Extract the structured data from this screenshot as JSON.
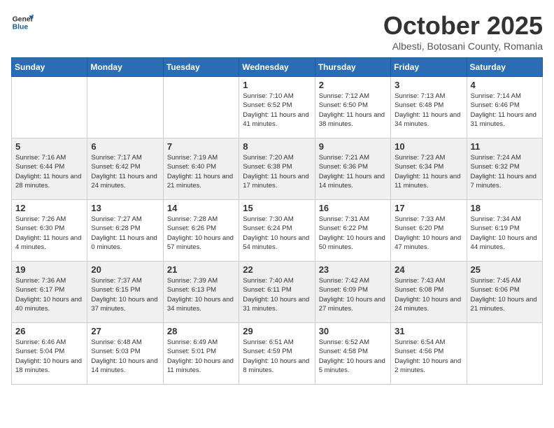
{
  "header": {
    "logo_line1": "General",
    "logo_line2": "Blue",
    "title": "October 2025",
    "subtitle": "Albesti, Botosani County, Romania"
  },
  "weekdays": [
    "Sunday",
    "Monday",
    "Tuesday",
    "Wednesday",
    "Thursday",
    "Friday",
    "Saturday"
  ],
  "weeks": [
    [
      {
        "day": "",
        "info": ""
      },
      {
        "day": "",
        "info": ""
      },
      {
        "day": "",
        "info": ""
      },
      {
        "day": "1",
        "info": "Sunrise: 7:10 AM\nSunset: 6:52 PM\nDaylight: 11 hours\nand 41 minutes."
      },
      {
        "day": "2",
        "info": "Sunrise: 7:12 AM\nSunset: 6:50 PM\nDaylight: 11 hours\nand 38 minutes."
      },
      {
        "day": "3",
        "info": "Sunrise: 7:13 AM\nSunset: 6:48 PM\nDaylight: 11 hours\nand 34 minutes."
      },
      {
        "day": "4",
        "info": "Sunrise: 7:14 AM\nSunset: 6:46 PM\nDaylight: 11 hours\nand 31 minutes."
      }
    ],
    [
      {
        "day": "5",
        "info": "Sunrise: 7:16 AM\nSunset: 6:44 PM\nDaylight: 11 hours\nand 28 minutes."
      },
      {
        "day": "6",
        "info": "Sunrise: 7:17 AM\nSunset: 6:42 PM\nDaylight: 11 hours\nand 24 minutes."
      },
      {
        "day": "7",
        "info": "Sunrise: 7:19 AM\nSunset: 6:40 PM\nDaylight: 11 hours\nand 21 minutes."
      },
      {
        "day": "8",
        "info": "Sunrise: 7:20 AM\nSunset: 6:38 PM\nDaylight: 11 hours\nand 17 minutes."
      },
      {
        "day": "9",
        "info": "Sunrise: 7:21 AM\nSunset: 6:36 PM\nDaylight: 11 hours\nand 14 minutes."
      },
      {
        "day": "10",
        "info": "Sunrise: 7:23 AM\nSunset: 6:34 PM\nDaylight: 11 hours\nand 11 minutes."
      },
      {
        "day": "11",
        "info": "Sunrise: 7:24 AM\nSunset: 6:32 PM\nDaylight: 11 hours\nand 7 minutes."
      }
    ],
    [
      {
        "day": "12",
        "info": "Sunrise: 7:26 AM\nSunset: 6:30 PM\nDaylight: 11 hours\nand 4 minutes."
      },
      {
        "day": "13",
        "info": "Sunrise: 7:27 AM\nSunset: 6:28 PM\nDaylight: 11 hours\nand 0 minutes."
      },
      {
        "day": "14",
        "info": "Sunrise: 7:28 AM\nSunset: 6:26 PM\nDaylight: 10 hours\nand 57 minutes."
      },
      {
        "day": "15",
        "info": "Sunrise: 7:30 AM\nSunset: 6:24 PM\nDaylight: 10 hours\nand 54 minutes."
      },
      {
        "day": "16",
        "info": "Sunrise: 7:31 AM\nSunset: 6:22 PM\nDaylight: 10 hours\nand 50 minutes."
      },
      {
        "day": "17",
        "info": "Sunrise: 7:33 AM\nSunset: 6:20 PM\nDaylight: 10 hours\nand 47 minutes."
      },
      {
        "day": "18",
        "info": "Sunrise: 7:34 AM\nSunset: 6:19 PM\nDaylight: 10 hours\nand 44 minutes."
      }
    ],
    [
      {
        "day": "19",
        "info": "Sunrise: 7:36 AM\nSunset: 6:17 PM\nDaylight: 10 hours\nand 40 minutes."
      },
      {
        "day": "20",
        "info": "Sunrise: 7:37 AM\nSunset: 6:15 PM\nDaylight: 10 hours\nand 37 minutes."
      },
      {
        "day": "21",
        "info": "Sunrise: 7:39 AM\nSunset: 6:13 PM\nDaylight: 10 hours\nand 34 minutes."
      },
      {
        "day": "22",
        "info": "Sunrise: 7:40 AM\nSunset: 6:11 PM\nDaylight: 10 hours\nand 31 minutes."
      },
      {
        "day": "23",
        "info": "Sunrise: 7:42 AM\nSunset: 6:09 PM\nDaylight: 10 hours\nand 27 minutes."
      },
      {
        "day": "24",
        "info": "Sunrise: 7:43 AM\nSunset: 6:08 PM\nDaylight: 10 hours\nand 24 minutes."
      },
      {
        "day": "25",
        "info": "Sunrise: 7:45 AM\nSunset: 6:06 PM\nDaylight: 10 hours\nand 21 minutes."
      }
    ],
    [
      {
        "day": "26",
        "info": "Sunrise: 6:46 AM\nSunset: 5:04 PM\nDaylight: 10 hours\nand 18 minutes."
      },
      {
        "day": "27",
        "info": "Sunrise: 6:48 AM\nSunset: 5:03 PM\nDaylight: 10 hours\nand 14 minutes."
      },
      {
        "day": "28",
        "info": "Sunrise: 6:49 AM\nSunset: 5:01 PM\nDaylight: 10 hours\nand 11 minutes."
      },
      {
        "day": "29",
        "info": "Sunrise: 6:51 AM\nSunset: 4:59 PM\nDaylight: 10 hours\nand 8 minutes."
      },
      {
        "day": "30",
        "info": "Sunrise: 6:52 AM\nSunset: 4:58 PM\nDaylight: 10 hours\nand 5 minutes."
      },
      {
        "day": "31",
        "info": "Sunrise: 6:54 AM\nSunset: 4:56 PM\nDaylight: 10 hours\nand 2 minutes."
      },
      {
        "day": "",
        "info": ""
      }
    ]
  ]
}
